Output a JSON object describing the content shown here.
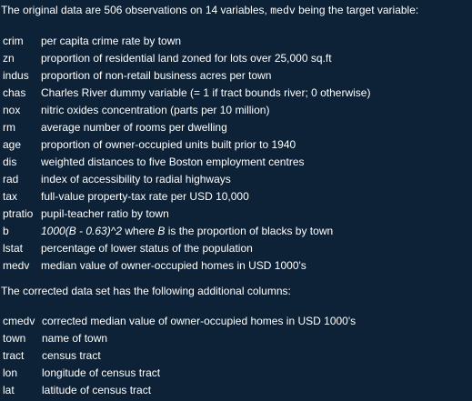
{
  "intro": {
    "prefix": "The original data are 506 observations on 14 variables, ",
    "code": "medv",
    "suffix": " being the target variable:"
  },
  "variables": [
    {
      "name": "crim",
      "desc": "per capita crime rate by town"
    },
    {
      "name": "zn",
      "desc": "proportion of residential land zoned for lots over 25,000 sq.ft"
    },
    {
      "name": "indus",
      "desc": "proportion of non-retail business acres per town"
    },
    {
      "name": "chas",
      "desc": "Charles River dummy variable (= 1 if tract bounds river; 0 otherwise)"
    },
    {
      "name": "nox",
      "desc": "nitric oxides concentration (parts per 10 million)"
    },
    {
      "name": "rm",
      "desc": "average number of rooms per dwelling"
    },
    {
      "name": "age",
      "desc": "proportion of owner-occupied units built prior to 1940"
    },
    {
      "name": "dis",
      "desc": "weighted distances to five Boston employment centres"
    },
    {
      "name": "rad",
      "desc": "index of accessibility to radial highways"
    },
    {
      "name": "tax",
      "desc": "full-value property-tax rate per USD 10,000"
    },
    {
      "name": "ptratio",
      "desc": "pupil-teacher ratio by town"
    },
    {
      "name": "b",
      "desc_math": "1000(B - 0.63)^2",
      "desc_mid": " where ",
      "desc_math2": "B",
      "desc_end": " is the proportion of blacks by town"
    },
    {
      "name": "lstat",
      "desc": "percentage of lower status of the population"
    },
    {
      "name": "medv",
      "desc": "median value of owner-occupied homes in USD 1000's"
    }
  ],
  "corrected_intro": "The corrected data set has the following additional columns:",
  "extra_columns": [
    {
      "name": "cmedv",
      "desc": "corrected median value of owner-occupied homes in USD 1000's"
    },
    {
      "name": "town",
      "desc": "name of town"
    },
    {
      "name": "tract",
      "desc": "census tract"
    },
    {
      "name": "lon",
      "desc": "longitude of census tract"
    },
    {
      "name": "lat",
      "desc": "latitude of census tract"
    }
  ]
}
